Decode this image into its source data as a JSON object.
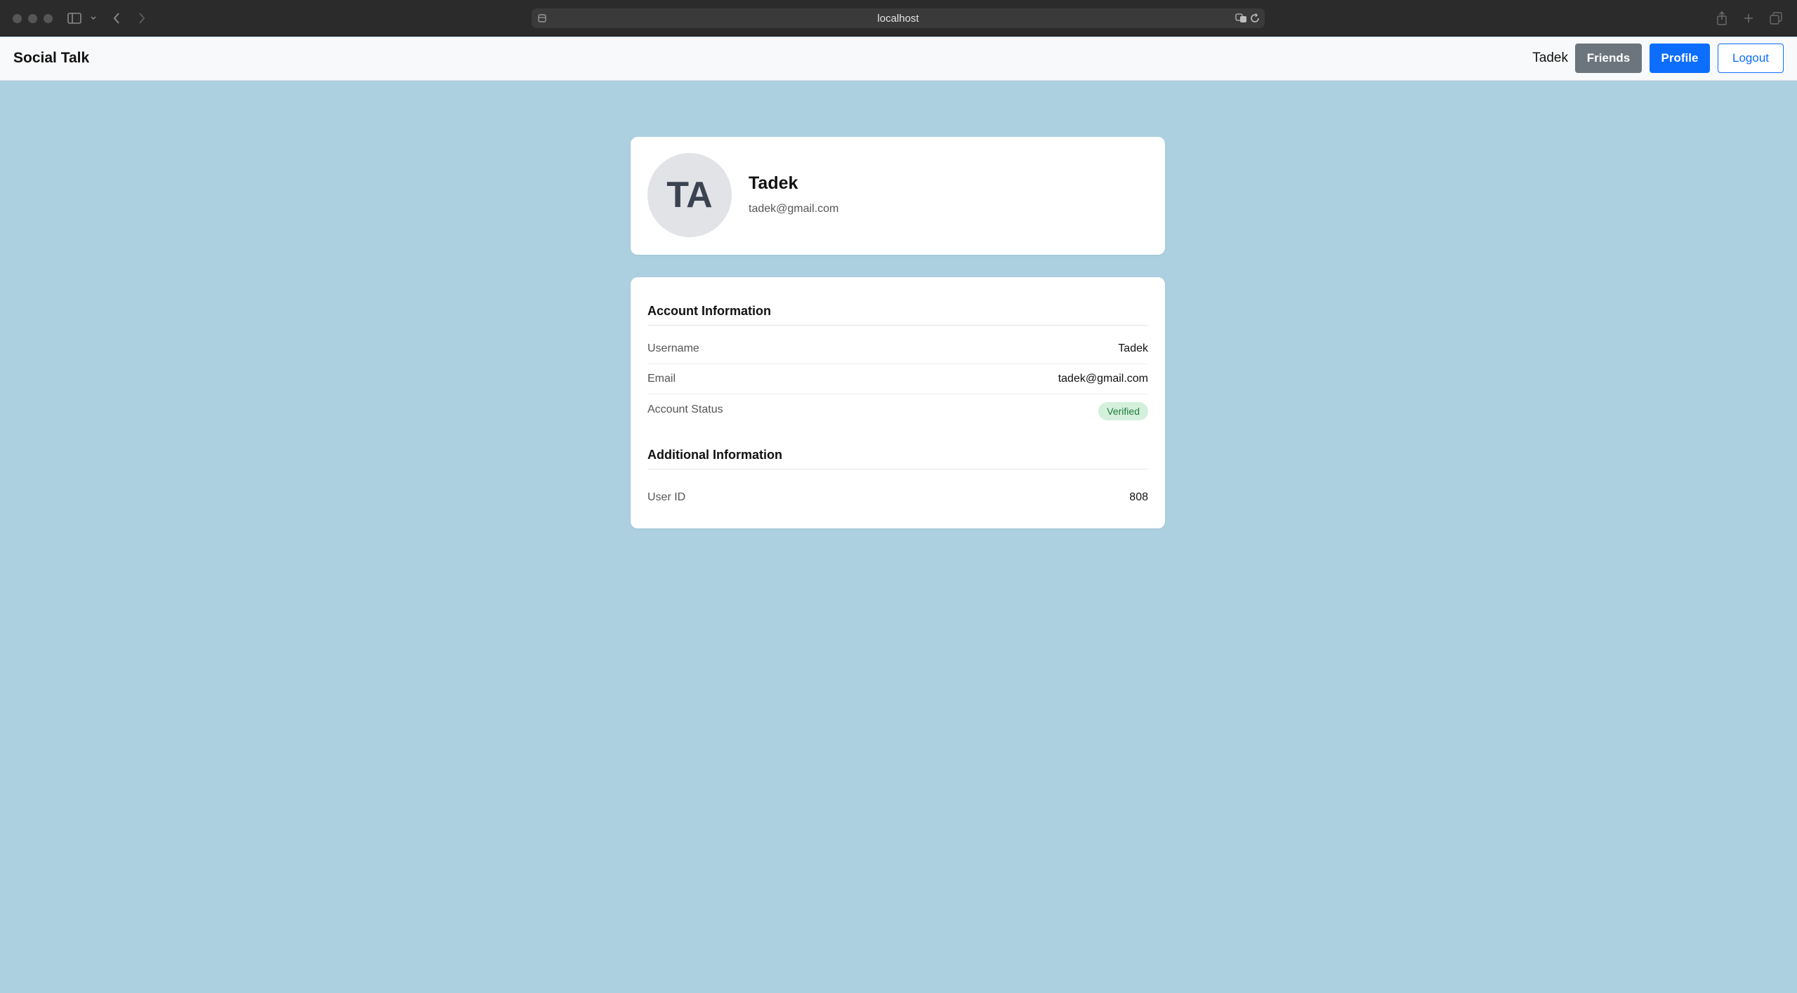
{
  "browser": {
    "url": "localhost"
  },
  "navbar": {
    "brand": "Social Talk",
    "username": "Tadek",
    "friends_label": "Friends",
    "profile_label": "Profile",
    "logout_label": "Logout"
  },
  "profile": {
    "initials": "TA",
    "name": "Tadek",
    "email": "tadek@gmail.com"
  },
  "account_section": {
    "title": "Account Information",
    "rows": [
      {
        "label": "Username",
        "value": "Tadek"
      },
      {
        "label": "Email",
        "value": "tadek@gmail.com"
      },
      {
        "label": "Account Status",
        "value": "Verified"
      }
    ]
  },
  "additional_section": {
    "title": "Additional Information",
    "rows": [
      {
        "label": "User ID",
        "value": "808"
      }
    ]
  },
  "colors": {
    "page_background": "#acd0e0",
    "primary": "#0d6efd",
    "secondary": "#6c757d",
    "verified_badge_bg": "#d4f0dc",
    "verified_badge_text": "#1e7a3a"
  }
}
